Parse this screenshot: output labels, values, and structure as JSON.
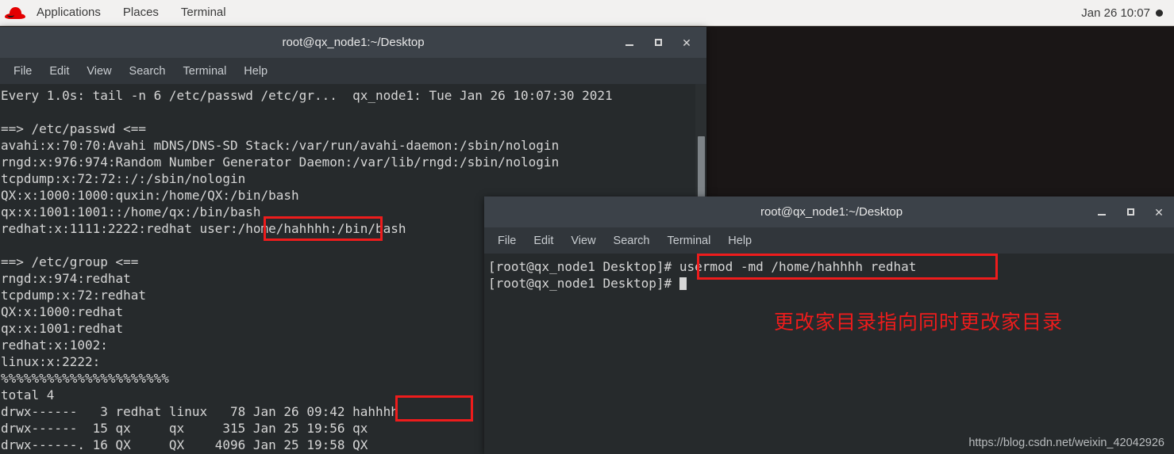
{
  "desktop": {
    "background_color": "#1a1616",
    "top_panel": {
      "logo_name": "redhat-logo",
      "items": [
        {
          "label": "Applications"
        },
        {
          "label": "Places"
        },
        {
          "label": "Terminal"
        }
      ],
      "clock": "Jan 26  10:07"
    },
    "watermark": "https://blog.csdn.net/weixin_42042926"
  },
  "annotations": {
    "chinese_note": "更改家目录指向同时更改家目录",
    "highlight_color": "#ee1c1c",
    "boxes": [
      {
        "name": "passwd-home-dir",
        "target": "/home/hahhhh:"
      },
      {
        "name": "ls-hahhhh-dir",
        "target": "hahhhh"
      },
      {
        "name": "usermod-command",
        "target": "usermod -md /home/hahhhh redhat"
      }
    ]
  },
  "terminal1": {
    "title": "root@qx_node1:~/Desktop",
    "menu": [
      {
        "label": "File"
      },
      {
        "label": "Edit"
      },
      {
        "label": "View"
      },
      {
        "label": "Search"
      },
      {
        "label": "Terminal"
      },
      {
        "label": "Help"
      }
    ],
    "window_buttons": {
      "minimize": "–",
      "maximize": "□",
      "close": "✕"
    },
    "lines": [
      "Every 1.0s: tail -n 6 /etc/passwd /etc/gr...  qx_node1: Tue Jan 26 10:07:30 2021",
      "",
      "==> /etc/passwd <==",
      "avahi:x:70:70:Avahi mDNS/DNS-SD Stack:/var/run/avahi-daemon:/sbin/nologin",
      "rngd:x:976:974:Random Number Generator Daemon:/var/lib/rngd:/sbin/nologin",
      "tcpdump:x:72:72::/:/sbin/nologin",
      "QX:x:1000:1000:quxin:/home/QX:/bin/bash",
      "qx:x:1001:1001::/home/qx:/bin/bash",
      "redhat:x:1111:2222:redhat user:/home/hahhhh:/bin/bash",
      "",
      "==> /etc/group <==",
      "rngd:x:974:redhat",
      "tcpdump:x:72:redhat",
      "QX:x:1000:redhat",
      "qx:x:1001:redhat",
      "redhat:x:1002:",
      "linux:x:2222:",
      "%%%%%%%%%%%%%%%%%%%%%%",
      "total 4",
      "drwx------   3 redhat linux   78 Jan 26 09:42 hahhhh",
      "drwx------  15 qx     qx     315 Jan 25 19:56 qx",
      "drwx------. 16 QX     QX    4096 Jan 25 19:58 QX"
    ]
  },
  "terminal2": {
    "title": "root@qx_node1:~/Desktop",
    "menu": [
      {
        "label": "File"
      },
      {
        "label": "Edit"
      },
      {
        "label": "View"
      },
      {
        "label": "Search"
      },
      {
        "label": "Terminal"
      },
      {
        "label": "Help"
      }
    ],
    "window_buttons": {
      "minimize": "–",
      "maximize": "□",
      "close": "✕"
    },
    "prompt": "[root@qx_node1 Desktop]# ",
    "command": "usermod -md /home/hahhhh redhat",
    "lines": [
      "[root@qx_node1 Desktop]# usermod -md /home/hahhhh redhat"
    ],
    "prompt_line2": "[root@qx_node1 Desktop]# "
  }
}
